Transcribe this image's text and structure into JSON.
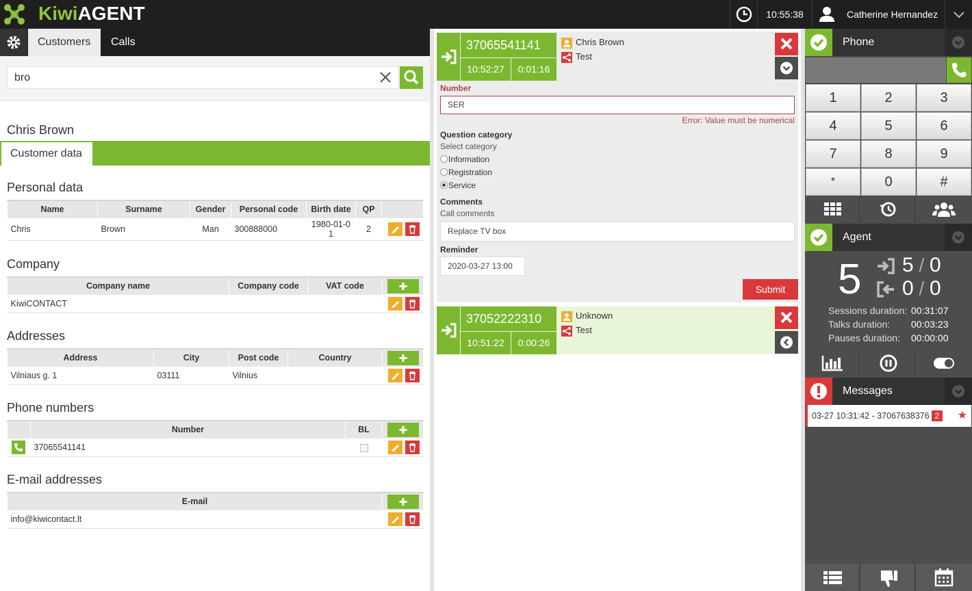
{
  "app": {
    "brand_kiwi": "Kiwi",
    "brand_agent": "AGENT",
    "time": "10:55:38",
    "user": "Catherine Hernandez"
  },
  "tabs": {
    "customers": "Customers",
    "calls": "Calls"
  },
  "search": {
    "value": "bro"
  },
  "customer": {
    "name": "Chris Brown",
    "tab": "Customer data",
    "personal": {
      "title": "Personal data",
      "headers": [
        "Name",
        "Surname",
        "Gender",
        "Personal code",
        "Birth date",
        "QP"
      ],
      "row": [
        "Chris",
        "Brown",
        "Man",
        "300888000",
        "1980-01-01",
        "2"
      ]
    },
    "company": {
      "title": "Company",
      "headers": [
        "Company name",
        "Company code",
        "VAT code"
      ],
      "row": [
        "KiwiCONTACT",
        "",
        ""
      ]
    },
    "addresses": {
      "title": "Addresses",
      "headers": [
        "Address",
        "City",
        "Post code",
        "Country"
      ],
      "row": [
        "Vilniaus g. 1",
        "03111",
        "Vilnius",
        ""
      ]
    },
    "phones": {
      "title": "Phone numbers",
      "headers": [
        "Number",
        "BL"
      ],
      "row": [
        "37065541141"
      ]
    },
    "emails": {
      "title": "E-mail addresses",
      "headers": [
        "E-mail"
      ],
      "row": [
        "info@kiwicontact.lt"
      ]
    }
  },
  "call1": {
    "number": "37065541141",
    "time": "10:52:27",
    "duration": "0:01:16",
    "contact": "Chris Brown",
    "campaign": "Test",
    "form": {
      "number_label": "Number",
      "number_value": "SER",
      "number_error": "Error: Value must be numerical",
      "category_label": "Question category",
      "category_sub": "Select category",
      "options": [
        "Information",
        "Registration",
        "Service"
      ],
      "selected": "Service",
      "comments_label": "Comments",
      "comments_sub": "Call comments",
      "comments_value": "Replace TV box",
      "reminder_label": "Reminder",
      "reminder_value": "2020-03-27 13:00",
      "submit": "Submit"
    }
  },
  "call2": {
    "number": "37052222310",
    "time": "10:51:22",
    "duration": "0:00:26",
    "contact": "Unknown",
    "campaign": "Test"
  },
  "phone": {
    "title": "Phone",
    "keys": [
      "1",
      "2",
      "3",
      "4",
      "5",
      "6",
      "7",
      "8",
      "9",
      "*",
      "0",
      "#"
    ]
  },
  "agent": {
    "title": "Agent",
    "count": "5",
    "in_a": "5",
    "in_b": "0",
    "out_a": "0",
    "out_b": "0",
    "sessions_label": "Sessions duration:",
    "sessions": "00:31:07",
    "talks_label": "Talks duration:",
    "talks": "00:03:23",
    "pauses_label": "Pauses duration:",
    "pauses": "00:00:00"
  },
  "messages": {
    "title": "Messages",
    "item": "03-27 10:31:42 - 37067638376",
    "count": "2"
  },
  "colors": {
    "green": "#7cb82f",
    "red": "#d9393b",
    "orange": "#f0ad2c",
    "dark": "#1f1f1f"
  }
}
